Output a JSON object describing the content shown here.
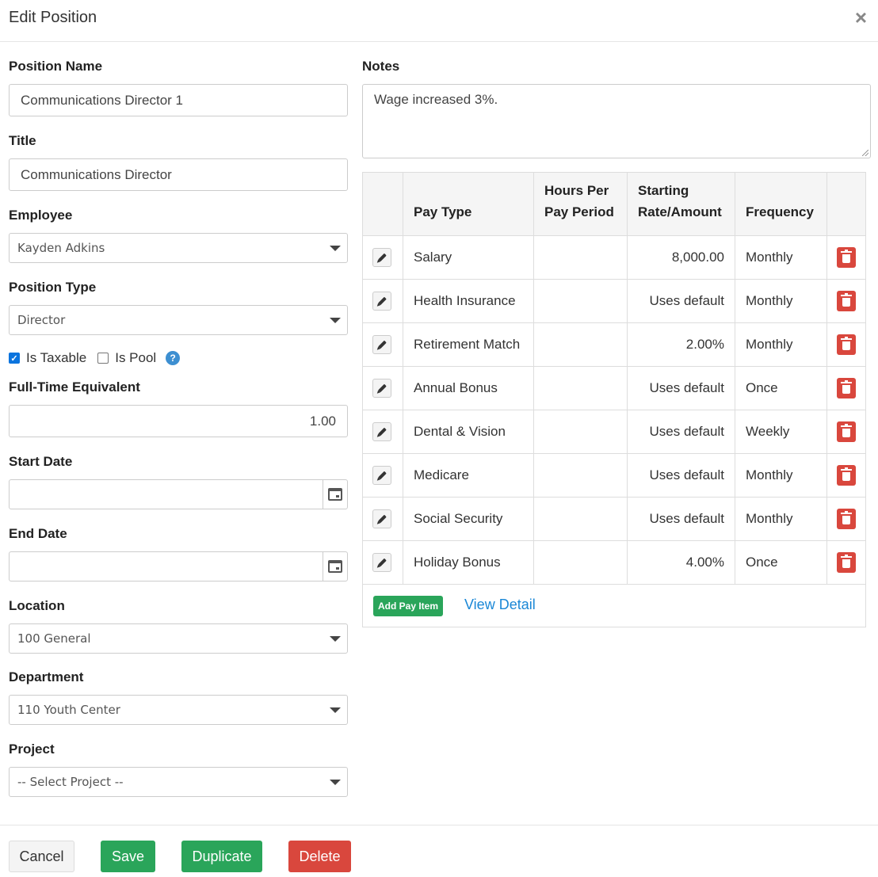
{
  "modal": {
    "title": "Edit Position",
    "close_glyph": "×"
  },
  "form": {
    "position_name": {
      "label": "Position Name",
      "value": "Communications Director 1"
    },
    "title": {
      "label": "Title",
      "value": "Communications Director"
    },
    "employee": {
      "label": "Employee",
      "value": "Kayden Adkins"
    },
    "position_type": {
      "label": "Position Type",
      "value": "Director"
    },
    "is_taxable": {
      "label": "Is Taxable",
      "checked": true
    },
    "is_pool": {
      "label": "Is Pool",
      "checked": false
    },
    "help_glyph": "?",
    "fte": {
      "label": "Full-Time Equivalent",
      "value": "1.00"
    },
    "start_date": {
      "label": "Start Date",
      "value": ""
    },
    "end_date": {
      "label": "End Date",
      "value": ""
    },
    "location": {
      "label": "Location",
      "value": "100 General"
    },
    "department": {
      "label": "Department",
      "value": "110 Youth Center"
    },
    "project": {
      "label": "Project",
      "value": "-- Select Project --"
    }
  },
  "notes": {
    "label": "Notes",
    "value": "Wage increased 3%."
  },
  "pay_table": {
    "headers": {
      "pay_type": "Pay Type",
      "hours_line1": "Hours Per",
      "hours_line2": "Pay Period",
      "rate_line1": "Starting",
      "rate_line2": "Rate/Amount",
      "frequency": "Frequency"
    },
    "rows": [
      {
        "pay_type": "Salary",
        "hours": "",
        "rate": "8,000.00",
        "frequency": "Monthly"
      },
      {
        "pay_type": "Health Insurance",
        "hours": "",
        "rate": "Uses default",
        "frequency": "Monthly"
      },
      {
        "pay_type": "Retirement Match",
        "hours": "",
        "rate": "2.00%",
        "frequency": "Monthly"
      },
      {
        "pay_type": "Annual Bonus",
        "hours": "",
        "rate": "Uses default",
        "frequency": "Once"
      },
      {
        "pay_type": "Dental & Vision",
        "hours": "",
        "rate": "Uses default",
        "frequency": "Weekly"
      },
      {
        "pay_type": "Medicare",
        "hours": "",
        "rate": "Uses default",
        "frequency": "Monthly"
      },
      {
        "pay_type": "Social Security",
        "hours": "",
        "rate": "Uses default",
        "frequency": "Monthly"
      },
      {
        "pay_type": "Holiday Bonus",
        "hours": "",
        "rate": "4.00%",
        "frequency": "Once"
      }
    ],
    "add_button": "Add Pay Item",
    "view_detail": "View Detail"
  },
  "footer": {
    "cancel": "Cancel",
    "save": "Save",
    "duplicate": "Duplicate",
    "delete": "Delete"
  },
  "colors": {
    "success": "#2aa55a",
    "danger": "#d9473d",
    "link": "#1a87d6",
    "help": "#3d8fd1"
  }
}
